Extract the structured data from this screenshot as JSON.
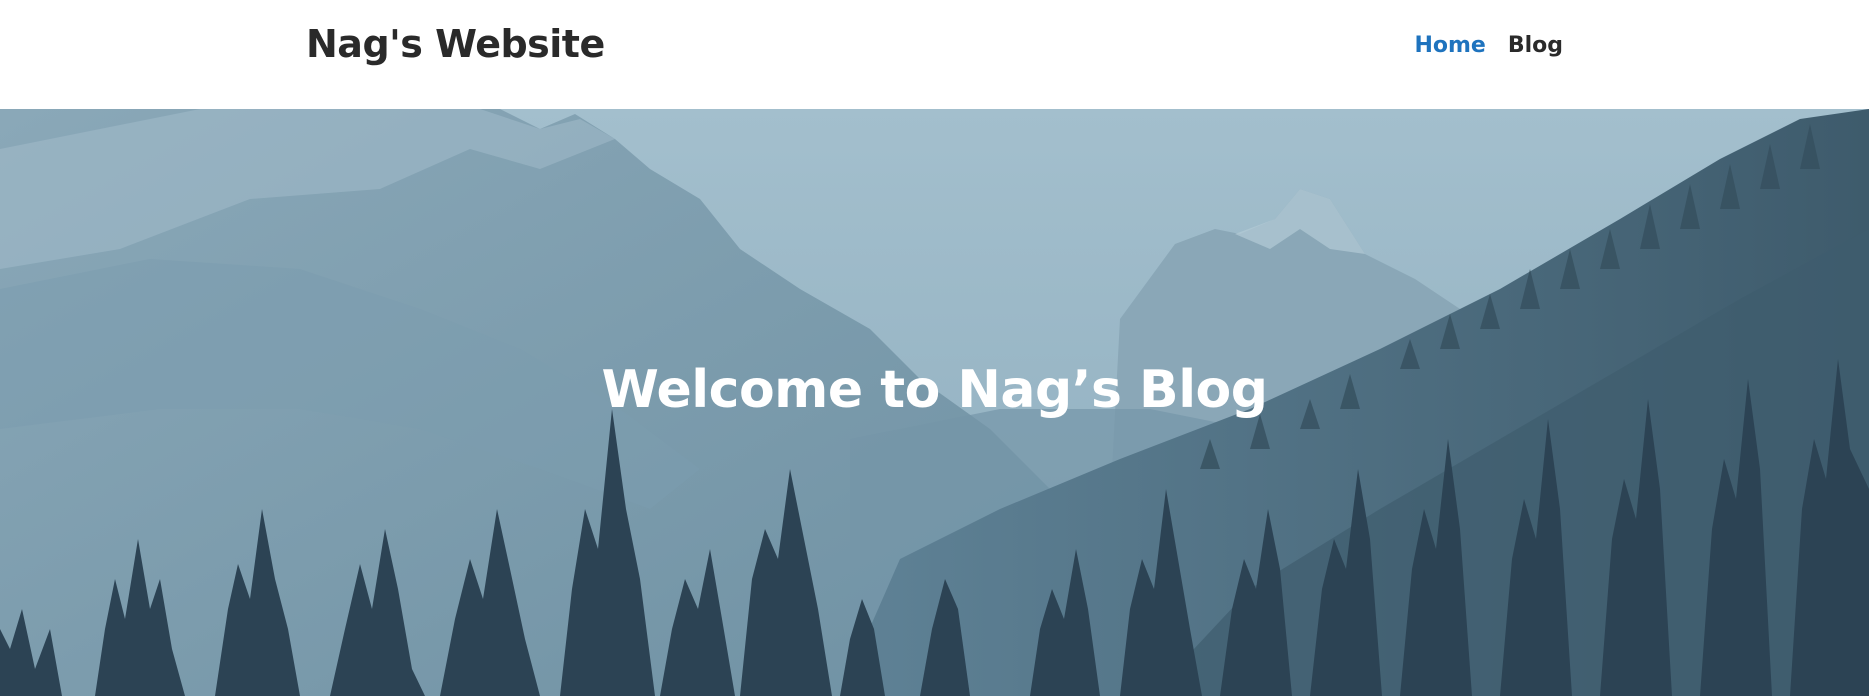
{
  "header": {
    "site_title": "Nag's Website",
    "nav": [
      {
        "label": "Home",
        "active": true
      },
      {
        "label": "Blog",
        "active": false
      }
    ]
  },
  "hero": {
    "title": "Welcome to Nag’s Blog",
    "background": "mountain-forest-image"
  },
  "colors": {
    "accent": "#1e73be",
    "text": "#2a2a2a",
    "hero_sky": "#9fbccb"
  }
}
